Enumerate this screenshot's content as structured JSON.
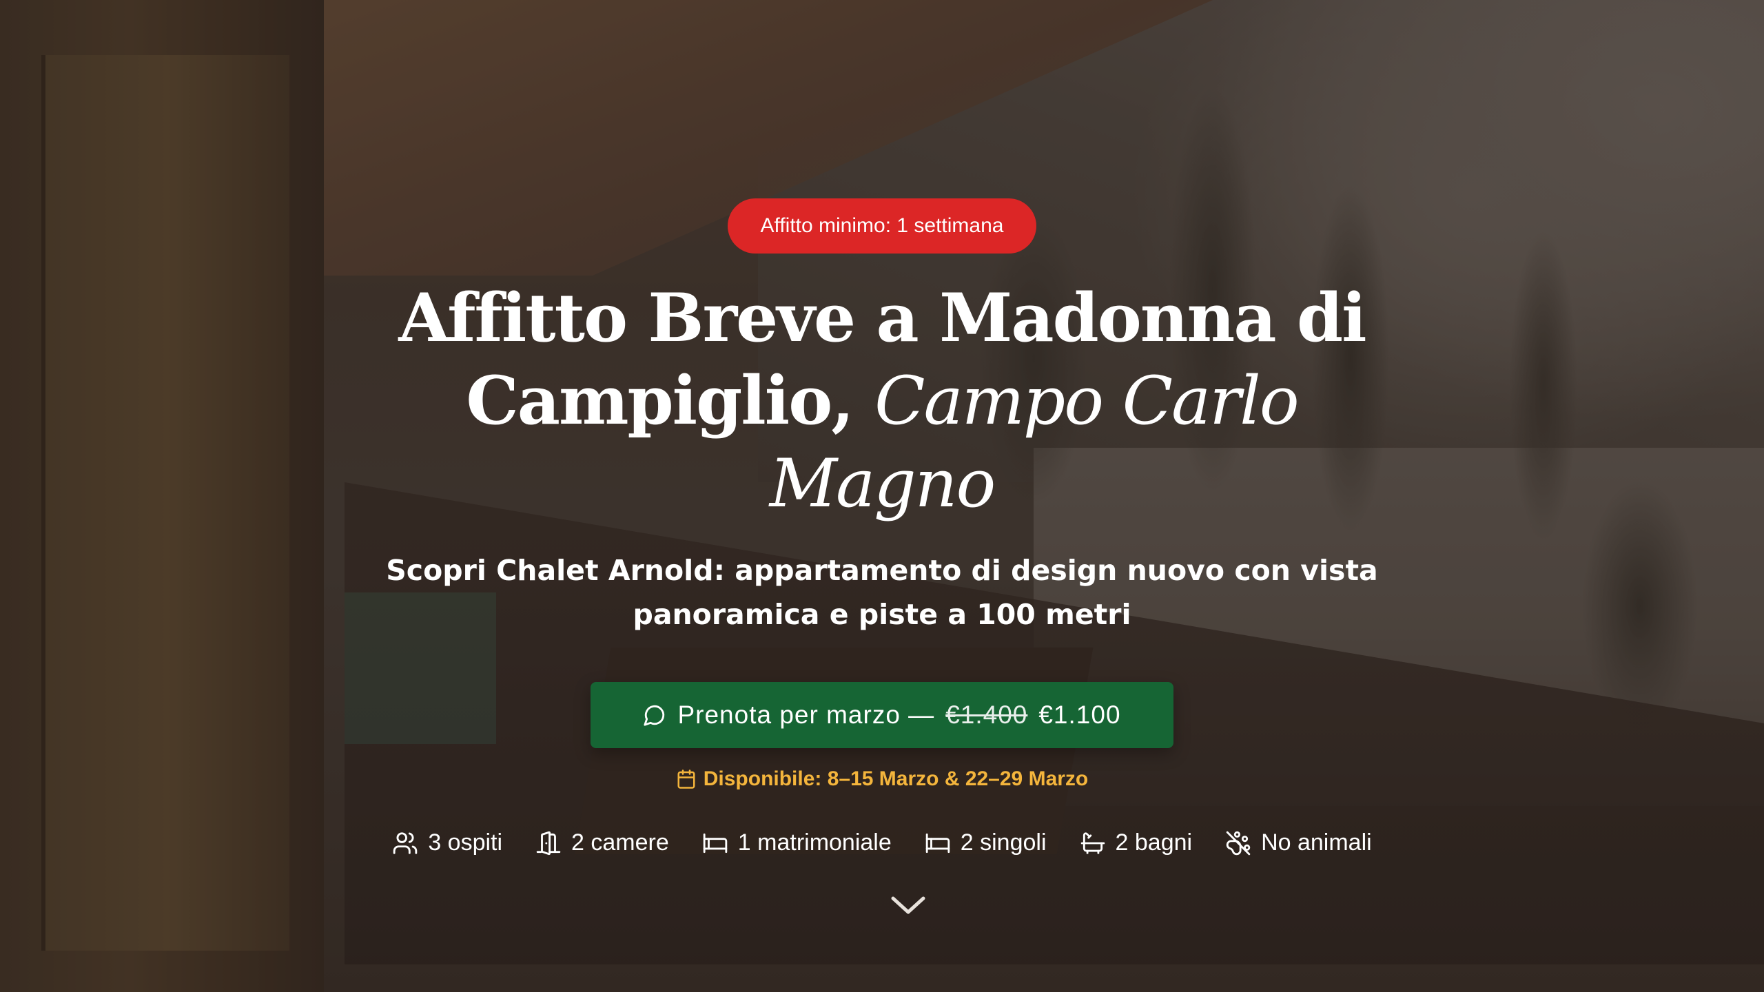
{
  "hero": {
    "badge": "Affitto minimo: 1 settimana",
    "title_main": "Affitto Breve a Madonna di Campiglio,",
    "title_accent": "Campo Carlo Magno",
    "subtitle": "Scopri Chalet Arnold: appartamento di design nuovo con vista panoramica e piste a 100 metri",
    "cta": {
      "icon": "message-circle-icon",
      "label": "Prenota per marzo —",
      "old_price": "€1.400",
      "new_price": "€1.100"
    },
    "availability": {
      "icon": "calendar-icon",
      "text": "Disponibile: 8–15 Marzo & 22–29 Marzo"
    },
    "features": [
      {
        "icon": "users-icon",
        "label": "3 ospiti"
      },
      {
        "icon": "door-icon",
        "label": "2 camere"
      },
      {
        "icon": "bed-icon",
        "label": "1 matrimoniale"
      },
      {
        "icon": "bed-icon",
        "label": "2 singoli"
      },
      {
        "icon": "bath-icon",
        "label": "2 bagni"
      },
      {
        "icon": "no-pets-icon",
        "label": "No animali"
      }
    ],
    "scroll_icon": "chevron-down-icon"
  },
  "colors": {
    "badge": "#dc2626",
    "cta": "#166534",
    "availability": "#f4b53c",
    "overlay": "#22181250"
  }
}
